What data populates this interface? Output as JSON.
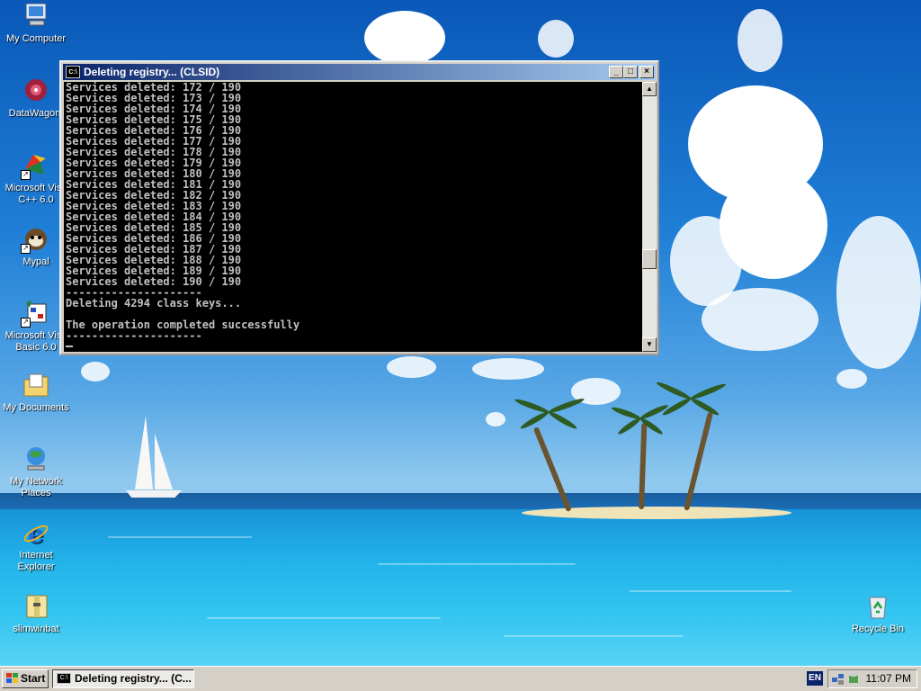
{
  "desktop": {
    "icons": [
      {
        "label": "My Computer",
        "icon": "my-computer-icon"
      },
      {
        "label": "DataWagon.",
        "icon": "datawagon-icon"
      },
      {
        "label": "Microsoft Visu C++ 6.0",
        "icon": "visual-cpp-icon"
      },
      {
        "label": "Mypal",
        "icon": "mypal-icon"
      },
      {
        "label": "Microsoft Visu Basic 6.0",
        "icon": "visual-basic-icon"
      },
      {
        "label": "My Documents",
        "icon": "my-documents-icon"
      },
      {
        "label": "My Network Places",
        "icon": "network-places-icon"
      },
      {
        "label": "Internet Explorer",
        "icon": "internet-explorer-icon"
      },
      {
        "label": "slimwinbat",
        "icon": "batch-file-icon"
      },
      {
        "label": "Recycle Bin",
        "icon": "recycle-bin-icon"
      }
    ]
  },
  "window": {
    "title": "Deleting registry... (CLSID)",
    "icon_text": "C:\\",
    "minimize": "_",
    "maximize": "□",
    "close": "×",
    "console_lines": [
      "Services deleted: 172 / 190",
      "Services deleted: 173 / 190",
      "Services deleted: 174 / 190",
      "Services deleted: 175 / 190",
      "Services deleted: 176 / 190",
      "Services deleted: 177 / 190",
      "Services deleted: 178 / 190",
      "Services deleted: 179 / 190",
      "Services deleted: 180 / 190",
      "Services deleted: 181 / 190",
      "Services deleted: 182 / 190",
      "Services deleted: 183 / 190",
      "Services deleted: 184 / 190",
      "Services deleted: 185 / 190",
      "Services deleted: 186 / 190",
      "Services deleted: 187 / 190",
      "Services deleted: 188 / 190",
      "Services deleted: 189 / 190",
      "Services deleted: 190 / 190",
      "---------------------",
      "Deleting 4294 class keys...",
      "",
      "The operation completed successfully",
      "---------------------"
    ],
    "scroll_up": "▲",
    "scroll_down": "▼"
  },
  "taskbar": {
    "start_label": "Start",
    "task_label": "Deleting registry... (C...",
    "task_icon_text": "C:\\",
    "language": "EN",
    "clock": "11:07 PM"
  },
  "colors": {
    "title_active": "#0a246a",
    "console_bg": "#000000",
    "console_text": "#c0c0c0",
    "taskbar": "#d4d0c8"
  }
}
